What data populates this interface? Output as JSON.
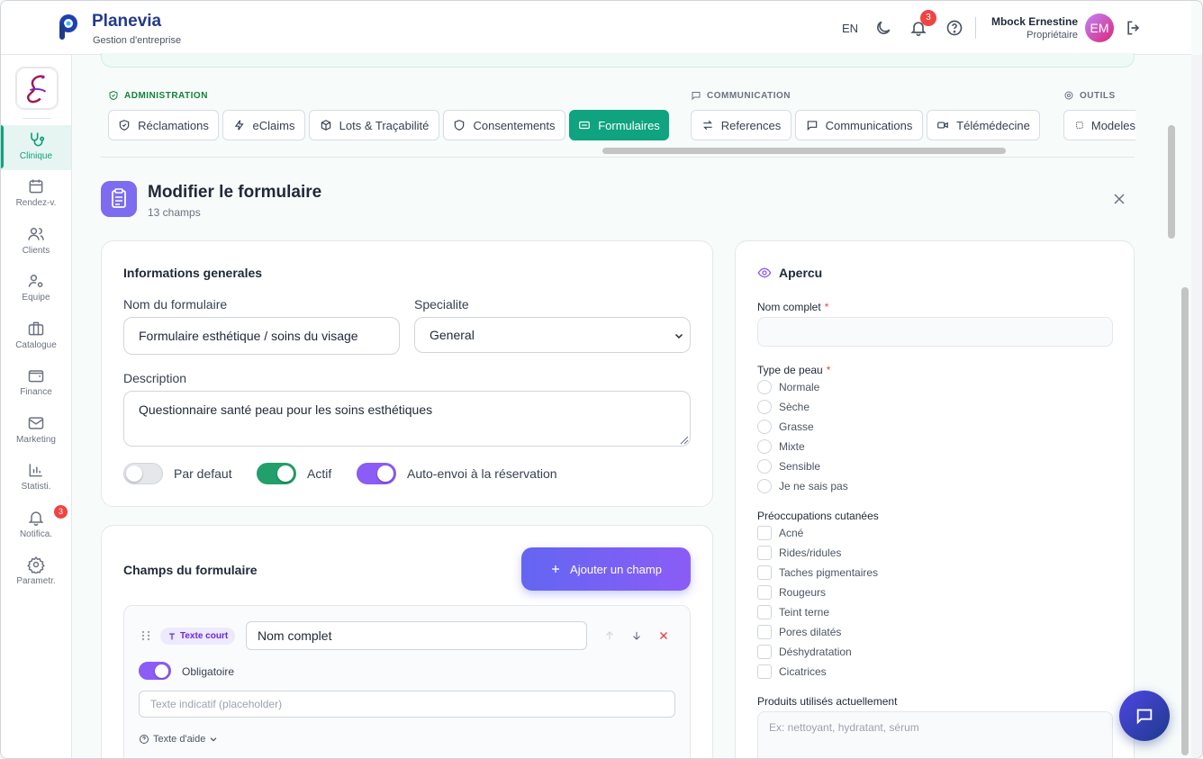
{
  "app": {
    "brand": "Planevia",
    "subtitle": "Gestion d'entreprise"
  },
  "topbar": {
    "lang": "EN",
    "notif_count": "3",
    "user_name": "Mbock Ernestine",
    "user_role": "Propriétaire",
    "avatar_initials": "EM"
  },
  "sidebar": {
    "items": [
      {
        "label": "Clinique",
        "icon": "stethoscope-icon"
      },
      {
        "label": "Rendez-v.",
        "icon": "calendar-icon"
      },
      {
        "label": "Clients",
        "icon": "users-icon"
      },
      {
        "label": "Equipe",
        "icon": "user-cog-icon"
      },
      {
        "label": "Catalogue",
        "icon": "briefcase-icon"
      },
      {
        "label": "Finance",
        "icon": "wallet-icon"
      },
      {
        "label": "Marketing",
        "icon": "mail-icon"
      },
      {
        "label": "Statisti.",
        "icon": "bar-chart-icon"
      },
      {
        "label": "Notifica.",
        "icon": "bell-icon"
      },
      {
        "label": "Parametr.",
        "icon": "gear-icon"
      }
    ],
    "notif_badge": "3"
  },
  "tab_groups": {
    "admin": "ADMINISTRATION",
    "communication": "COMMUNICATION",
    "outils": "OUTILS"
  },
  "tabs": [
    "Réclamations",
    "eClaims",
    "Lots & Traçabilité",
    "Consentements",
    "Formulaires",
    "References",
    "Communications",
    "Télémédecine",
    "Modeles"
  ],
  "header": {
    "title": "Modifier le formulaire",
    "subtitle": "13 champs"
  },
  "general": {
    "title": "Informations generales",
    "name_label": "Nom du formulaire",
    "name_value": "Formulaire esthétique / soins du visage",
    "specialty_label": "Specialite",
    "specialty_value": "General",
    "description_label": "Description",
    "description_value": "Questionnaire santé peau pour les soins esthétiques",
    "toggles": {
      "default": {
        "label": "Par defaut",
        "on": false
      },
      "active": {
        "label": "Actif",
        "on": true
      },
      "auto_send": {
        "label": "Auto-envoi à la réservation",
        "on": true
      }
    }
  },
  "fields": {
    "title": "Champs du formulaire",
    "add_button": "Ajouter un champ",
    "items": [
      {
        "type": "Texte court",
        "name": "Nom complet",
        "required_label": "Obligatoire",
        "placeholder_hint": "Texte indicatif (placeholder)",
        "help_toggle": "Texte d'aide"
      }
    ]
  },
  "preview": {
    "title": "Apercu",
    "full_name_label": "Nom complet",
    "skin_type_label": "Type de peau",
    "skin_types": [
      "Normale",
      "Sèche",
      "Grasse",
      "Mixte",
      "Sensible",
      "Je ne sais pas"
    ],
    "concerns_label": "Préoccupations cutanées",
    "concerns": [
      "Acné",
      "Rides/ridules",
      "Taches pigmentaires",
      "Rougeurs",
      "Teint terne",
      "Pores dilatés",
      "Déshydratation",
      "Cicatrices"
    ],
    "products_label": "Produits utilisés actuellement",
    "products_placeholder": "Ex: nettoyant, hydratant, sérum",
    "required_mark": "*"
  },
  "colors": {
    "accent_teal": "#10a37f",
    "accent_purple": "#8b5cf6",
    "brand_blue": "#243b8a",
    "danger": "#ef4444"
  }
}
